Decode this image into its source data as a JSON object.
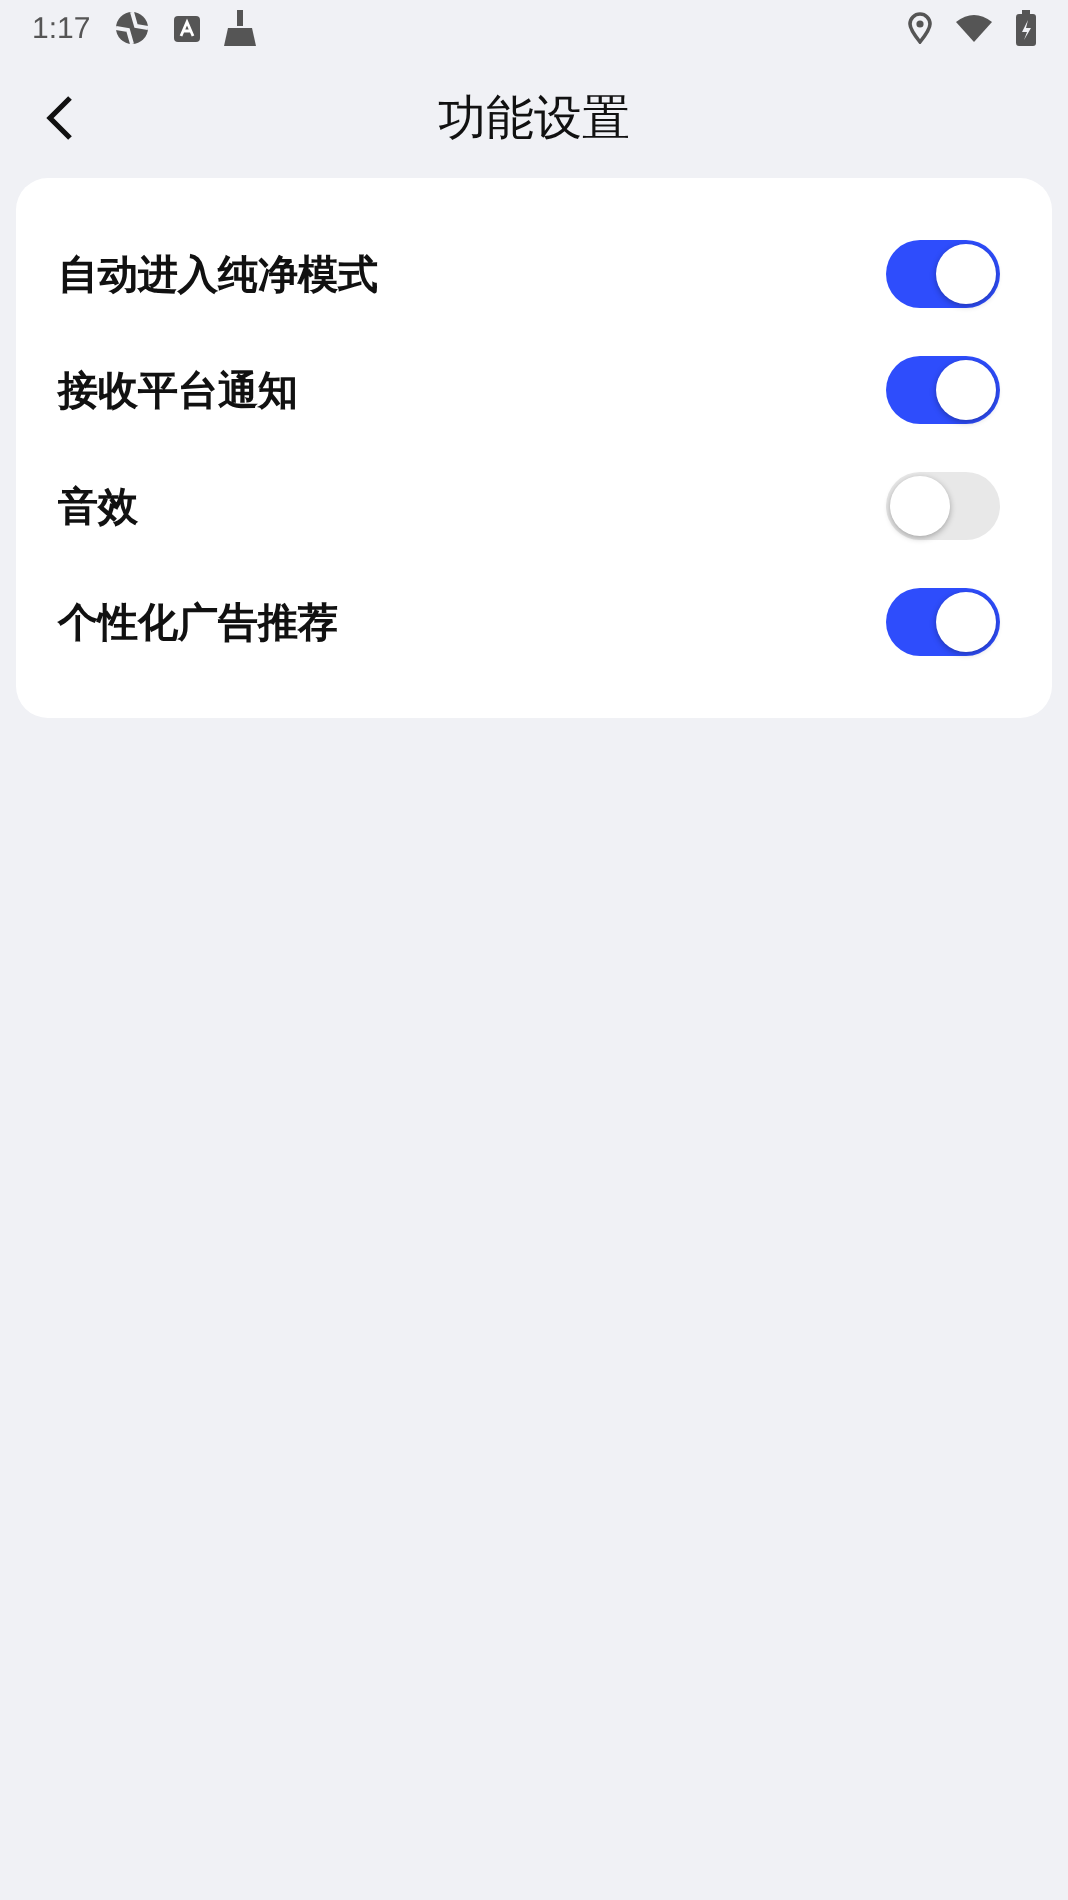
{
  "status_bar": {
    "time": "1:17"
  },
  "header": {
    "title": "功能设置"
  },
  "settings": [
    {
      "label": "自动进入纯净模式",
      "on": true
    },
    {
      "label": "接收平台通知",
      "on": true
    },
    {
      "label": "音效",
      "on": false
    },
    {
      "label": "个性化广告推荐",
      "on": true
    }
  ]
}
